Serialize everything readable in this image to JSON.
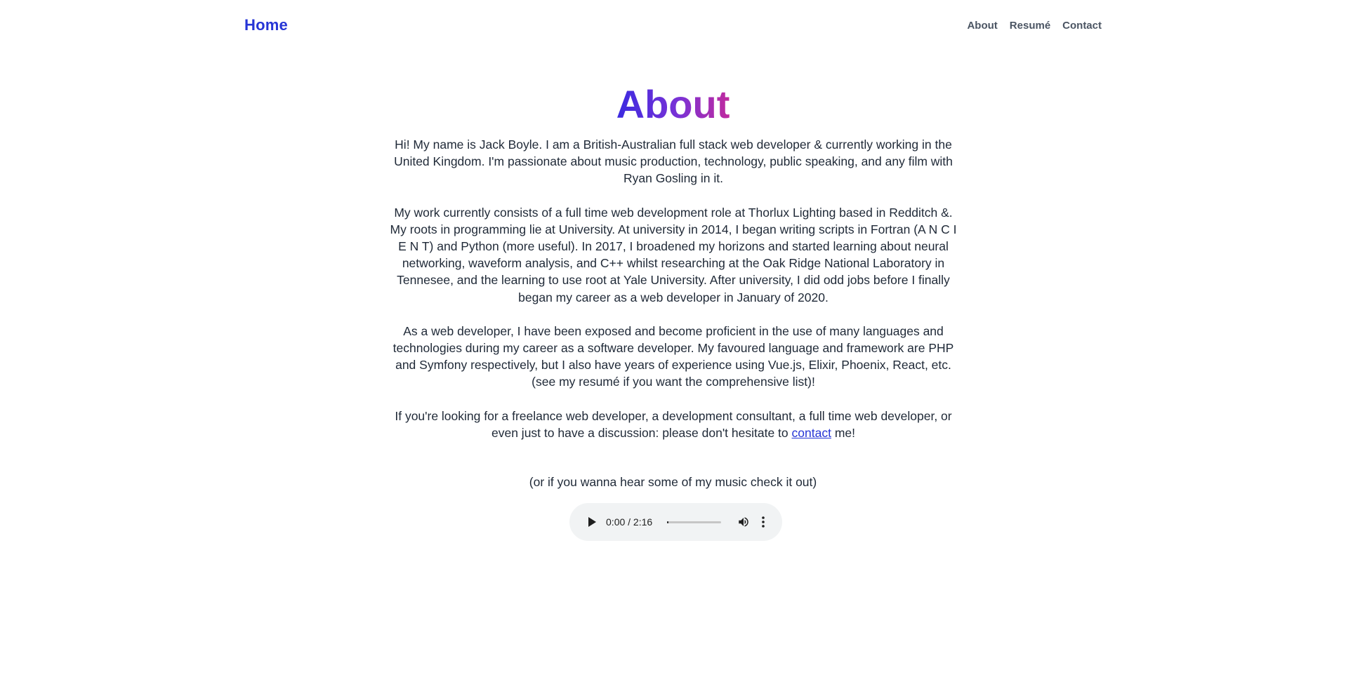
{
  "nav": {
    "home_label": "Home",
    "links": [
      {
        "label": "About"
      },
      {
        "label": "Resumé"
      },
      {
        "label": "Contact"
      }
    ]
  },
  "page": {
    "title": "About",
    "title_gradient": [
      "#3b2ae0",
      "#c02a9e"
    ],
    "accent_color": "#2635d6"
  },
  "paragraphs": {
    "p1": "Hi! My name is Jack Boyle. I am a British-Australian full stack web developer & currently working in the United Kingdom. I'm passionate about music production, technology, public speaking, and any film with Ryan Gosling in it.",
    "p2": "My work currently consists of a full time web development role at Thorlux Lighting based in Redditch &. My roots in programming lie at University. At university in 2014, I began writing scripts in Fortran (A N C I E N T) and Python (more useful). In 2017, I broadened my horizons and started learning about neural networking, waveform analysis, and C++ whilst researching at the Oak Ridge National Laboratory in Tennesee, and the learning to use root at Yale University. After university, I did odd jobs before I finally began my career as a web developer in January of 2020.",
    "p3": "As a web developer, I have been exposed and become proficient in the use of many languages and technologies during my career as a software developer. My favoured language and framework are PHP and Symfony respectively, but I also have years of experience using Vue.js, Elixir, Phoenix, React, etc. (see my resumé if you want the comprehensive list)!",
    "p4_before": "If you're looking for a freelance web developer, a development consultant, a full time web developer, or even just to have a discussion: please don't hesitate to ",
    "p4_link": "contact",
    "p4_after": " me!"
  },
  "music": {
    "note": "(or if you wanna hear some of my music check it out)",
    "player": {
      "time": "0:00 / 2:16",
      "progress": 0,
      "play_icon": "play-icon",
      "volume_icon": "volume-icon",
      "menu_icon": "more-vert-icon"
    }
  }
}
